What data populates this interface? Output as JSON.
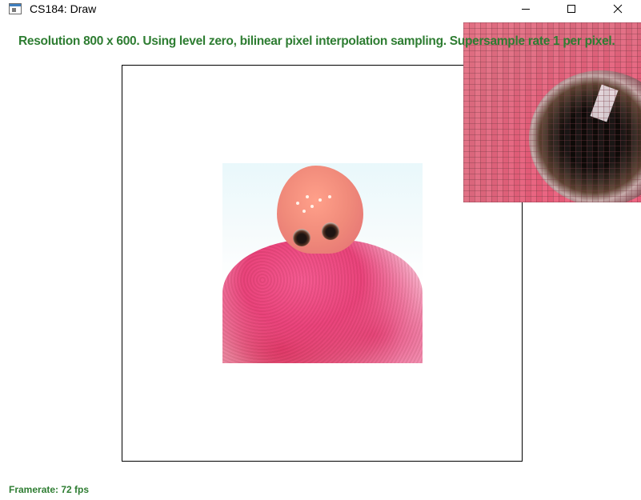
{
  "window": {
    "title": "CS184: Draw",
    "minimize_icon": "minimize-icon",
    "maximize_icon": "maximize-icon",
    "close_icon": "close-icon"
  },
  "hud": {
    "status_text": "Resolution 800 x 600. Using level zero, bilinear pixel interpolation sampling. Supersample rate 1 per pixel.",
    "framerate_text": "Framerate: 72 fps"
  },
  "colors": {
    "hud_text": "#2e7d32",
    "frame_border": "#000000",
    "background": "#ffffff"
  }
}
